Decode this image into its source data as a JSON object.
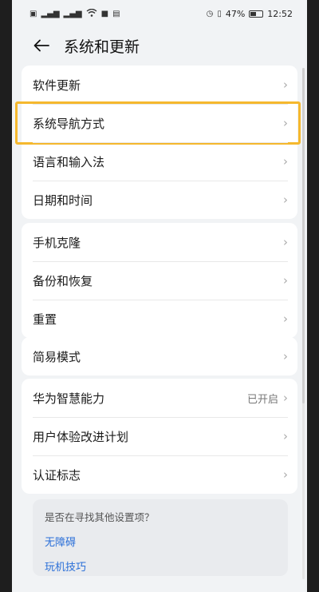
{
  "status": {
    "battery_percent": "47%",
    "time": "12:52",
    "left_icons": [
      "sim-icon",
      "signal-icon",
      "signal-icon",
      "wifi-icon",
      "camera-icon",
      "gallery-icon"
    ],
    "right_icons": [
      "alarm-icon",
      "vibrate-icon",
      "battery-icon"
    ]
  },
  "header": {
    "back_icon": "arrow-left-icon",
    "title": "系统和更新"
  },
  "groups": [
    {
      "items": [
        {
          "label": "软件更新"
        },
        {
          "label": "系统导航方式",
          "highlighted": true
        },
        {
          "label": "语言和输入法"
        },
        {
          "label": "日期和时间"
        }
      ]
    },
    {
      "items": [
        {
          "label": "手机克隆"
        },
        {
          "label": "备份和恢复"
        },
        {
          "label": "重置"
        }
      ]
    },
    {
      "items": [
        {
          "label": "简易模式"
        }
      ]
    },
    {
      "items": [
        {
          "label": "华为智慧能力",
          "value": "已开启"
        },
        {
          "label": "用户体验改进计划"
        },
        {
          "label": "认证标志"
        }
      ]
    }
  ],
  "suggest": {
    "question": "是否在寻找其他设置项？",
    "links": [
      "无障碍",
      "玩机技巧"
    ]
  },
  "colors": {
    "highlight": "#f5b82e",
    "link": "#2a6fd8",
    "background": "#f1f3f5"
  }
}
